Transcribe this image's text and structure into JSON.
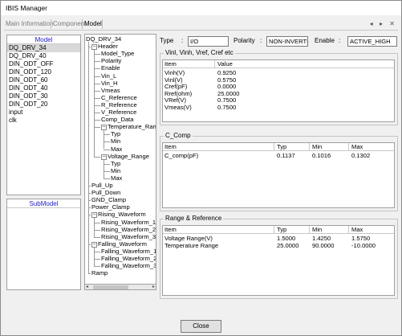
{
  "window": {
    "title": "IBIS Manager"
  },
  "tabs": [
    "Main Information",
    "Component",
    "Model"
  ],
  "tab_arrows": [
    "◂",
    "▸",
    "✕"
  ],
  "model_list": {
    "header": "Model",
    "items": [
      "DQ_DRV_34",
      "DQ_DRV_40",
      "DIN_ODT_OFF",
      "DIN_ODT_120",
      "DIN_ODT_60",
      "DIN_ODT_40",
      "DIN_ODT_30",
      "DIN_ODT_20",
      "input",
      "clk"
    ],
    "selected_index": 0
  },
  "submodel_list": {
    "header": "SubModel",
    "items": []
  },
  "tree": {
    "nodes": [
      {
        "label": "DQ_DRV_34",
        "level": 0,
        "toggle": ""
      },
      {
        "label": "Header",
        "level": 1,
        "toggle": "-"
      },
      {
        "label": "Model_Type",
        "level": 2,
        "toggle": ""
      },
      {
        "label": "Polarity",
        "level": 2,
        "toggle": ""
      },
      {
        "label": "Enable",
        "level": 2,
        "toggle": ""
      },
      {
        "label": "Vin_L",
        "level": 2,
        "toggle": ""
      },
      {
        "label": "Vin_H",
        "level": 2,
        "toggle": ""
      },
      {
        "label": "Vmeas",
        "level": 2,
        "toggle": ""
      },
      {
        "label": "C_Reference",
        "level": 2,
        "toggle": ""
      },
      {
        "label": "R_Reference",
        "level": 2,
        "toggle": ""
      },
      {
        "label": "V_Reference",
        "level": 2,
        "toggle": ""
      },
      {
        "label": "Comp_Data",
        "level": 2,
        "toggle": ""
      },
      {
        "label": "Temperature_Rang",
        "level": 2,
        "toggle": "-"
      },
      {
        "label": "Typ",
        "level": 3,
        "toggle": ""
      },
      {
        "label": "Min",
        "level": 3,
        "toggle": ""
      },
      {
        "label": "Max",
        "level": 3,
        "toggle": ""
      },
      {
        "label": "Voltage_Range",
        "level": 2,
        "toggle": "-"
      },
      {
        "label": "Typ",
        "level": 3,
        "toggle": ""
      },
      {
        "label": "Min",
        "level": 3,
        "toggle": ""
      },
      {
        "label": "Max",
        "level": 3,
        "toggle": ""
      },
      {
        "label": "Pull_Up",
        "level": 1,
        "toggle": ""
      },
      {
        "label": "Pull_Down",
        "level": 1,
        "toggle": ""
      },
      {
        "label": "GND_Clamp",
        "level": 1,
        "toggle": ""
      },
      {
        "label": "Power_Clamp",
        "level": 1,
        "toggle": ""
      },
      {
        "label": "Rising_Waveform",
        "level": 1,
        "toggle": "-"
      },
      {
        "label": "Rising_Waveform_1",
        "level": 2,
        "toggle": ""
      },
      {
        "label": "Rising_Waveform_2",
        "level": 2,
        "toggle": ""
      },
      {
        "label": "Rising_Waveform_3",
        "level": 2,
        "toggle": ""
      },
      {
        "label": "Falling_Waveform",
        "level": 1,
        "toggle": "-"
      },
      {
        "label": "Falling_Waveform_1",
        "level": 2,
        "toggle": ""
      },
      {
        "label": "Falling_Waveform_2",
        "level": 2,
        "toggle": ""
      },
      {
        "label": "Falling_Waveform_3",
        "level": 2,
        "toggle": ""
      },
      {
        "label": "Ramp",
        "level": 1,
        "toggle": ""
      }
    ]
  },
  "props": {
    "type_label": "Type",
    "type_value": "I/O",
    "polarity_label": "Polarity",
    "polarity_value": "NON-INVERTIN",
    "enable_label": "Enable",
    "enable_value": "ACTIVE_HIGH",
    "colon": ":"
  },
  "vinl_group": {
    "title": "Vinl, Vinh, Vref, Cref etc",
    "columns": [
      "Item",
      "Value"
    ],
    "rows": [
      [
        "Vinh(V)",
        "0.9250"
      ],
      [
        "Vinl(V)",
        "0.5750"
      ],
      [
        "Cref(pF)",
        "0.0000"
      ],
      [
        "Rref(ohm)",
        "25.0000"
      ],
      [
        "VRef(V)",
        "0.7500"
      ],
      [
        "Vmeas(V)",
        "0.7500"
      ]
    ]
  },
  "ccomp_group": {
    "title": "C_Comp",
    "columns": [
      "Item",
      "Typ",
      "Min",
      "Max"
    ],
    "rows": [
      [
        "C_comp(pF)",
        "0.1137",
        "0.1016",
        "0.1302"
      ]
    ]
  },
  "range_group": {
    "title": "Range & Reference",
    "columns": [
      "Item",
      "Typ",
      "Min",
      "Max"
    ],
    "rows": [
      [
        "Voltage Range(V)",
        "1.5000",
        "1.4250",
        "1.5750"
      ],
      [
        "Temperature Range",
        "25.0000",
        "90.0000",
        "-10.0000"
      ]
    ]
  },
  "close_button": "Close"
}
